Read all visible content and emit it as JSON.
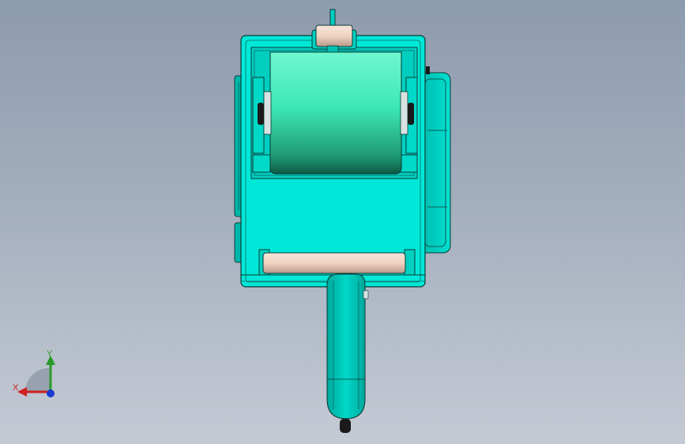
{
  "viewport": {
    "background_top": "#8d9bae",
    "background_bottom": "#c4cad4"
  },
  "model": {
    "colors": {
      "body": "#00e8d8",
      "body_dark": "#00a59a",
      "edge": "#0a3a36",
      "roller_light": "#5cf5c8",
      "roller_dark": "#1a7a5a",
      "rod": "#f0d6c6",
      "handle": "#00c8ba",
      "knob": "#1a1a1a"
    }
  },
  "triad": {
    "x_label": "X",
    "y_label": "Y",
    "x_color": "#d02020",
    "y_color": "#2a9a2a",
    "z_color": "#1a3ad0",
    "icon": "coordinate-triad-icon"
  }
}
